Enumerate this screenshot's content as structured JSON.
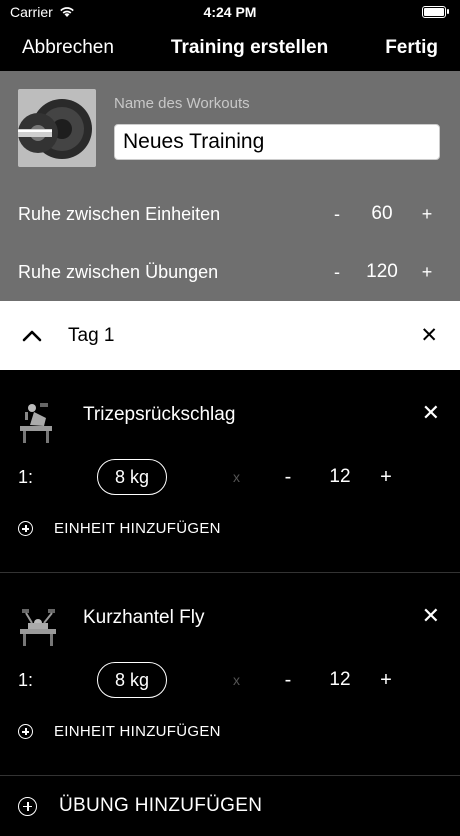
{
  "status": {
    "carrier": "Carrier",
    "time": "4:24 PM",
    "battery_level": 1.0
  },
  "nav": {
    "cancel": "Abbrechen",
    "title": "Training erstellen",
    "done": "Fertig"
  },
  "workout": {
    "name_label": "Name des Workouts",
    "name_value": "Neues Training",
    "rest_sets": {
      "label": "Ruhe zwischen Einheiten",
      "minus": "-",
      "value": "60",
      "plus": "+"
    },
    "rest_exercises": {
      "label": "Ruhe zwischen Übungen",
      "minus": "-",
      "value": "120",
      "plus": "+"
    }
  },
  "day": {
    "title": "Tag 1",
    "remove": "✕"
  },
  "exercises": [
    {
      "name": "Trizepsrückschlag",
      "remove": "✕",
      "set_index": "1:",
      "weight": "8 kg",
      "x": "x",
      "minus": "-",
      "reps": "12",
      "plus": "+",
      "add_set": "EINHEIT HINZUFÜGEN"
    },
    {
      "name": "Kurzhantel Fly",
      "remove": "✕",
      "set_index": "1:",
      "weight": "8 kg",
      "x": "x",
      "minus": "-",
      "reps": "12",
      "plus": "+",
      "add_set": "EINHEIT HINZUFÜGEN"
    }
  ],
  "add_exercise": "ÜBUNG HINZUFÜGEN"
}
